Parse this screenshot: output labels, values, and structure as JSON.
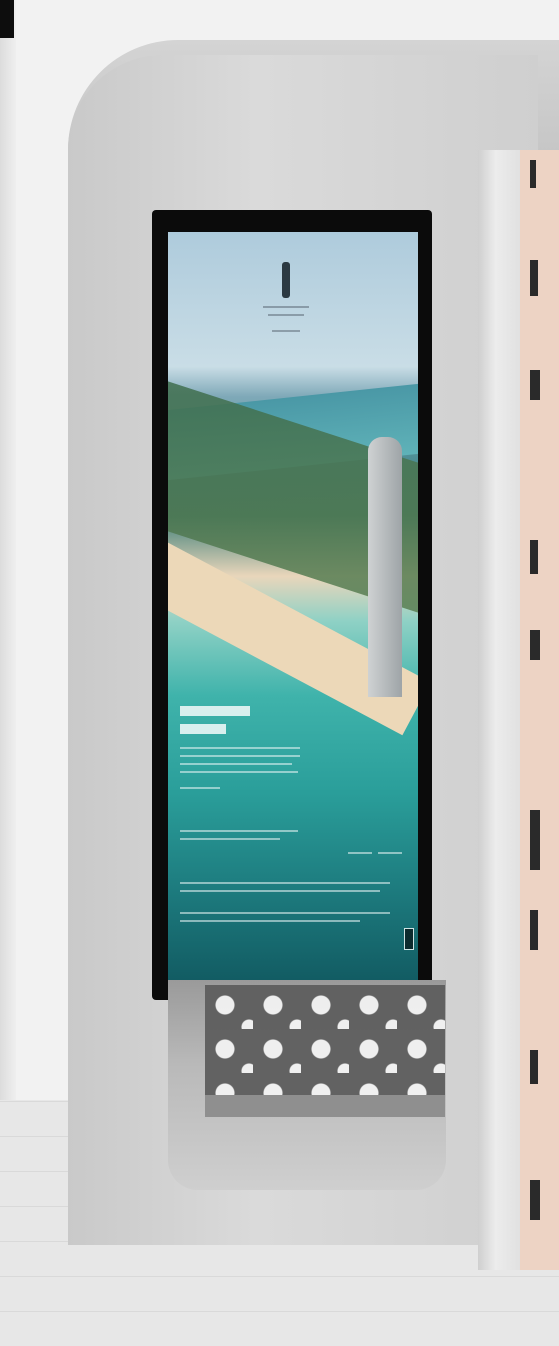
{
  "scene": {
    "kind": "bus-shelter-digital-billboard",
    "colors": {
      "shelter": "#d2d2d2",
      "frame": "#0b0b0b",
      "back_wall": "#edd3c4",
      "floor": "#e6e6e6"
    }
  },
  "poster": {
    "headline": "",
    "body": ""
  }
}
